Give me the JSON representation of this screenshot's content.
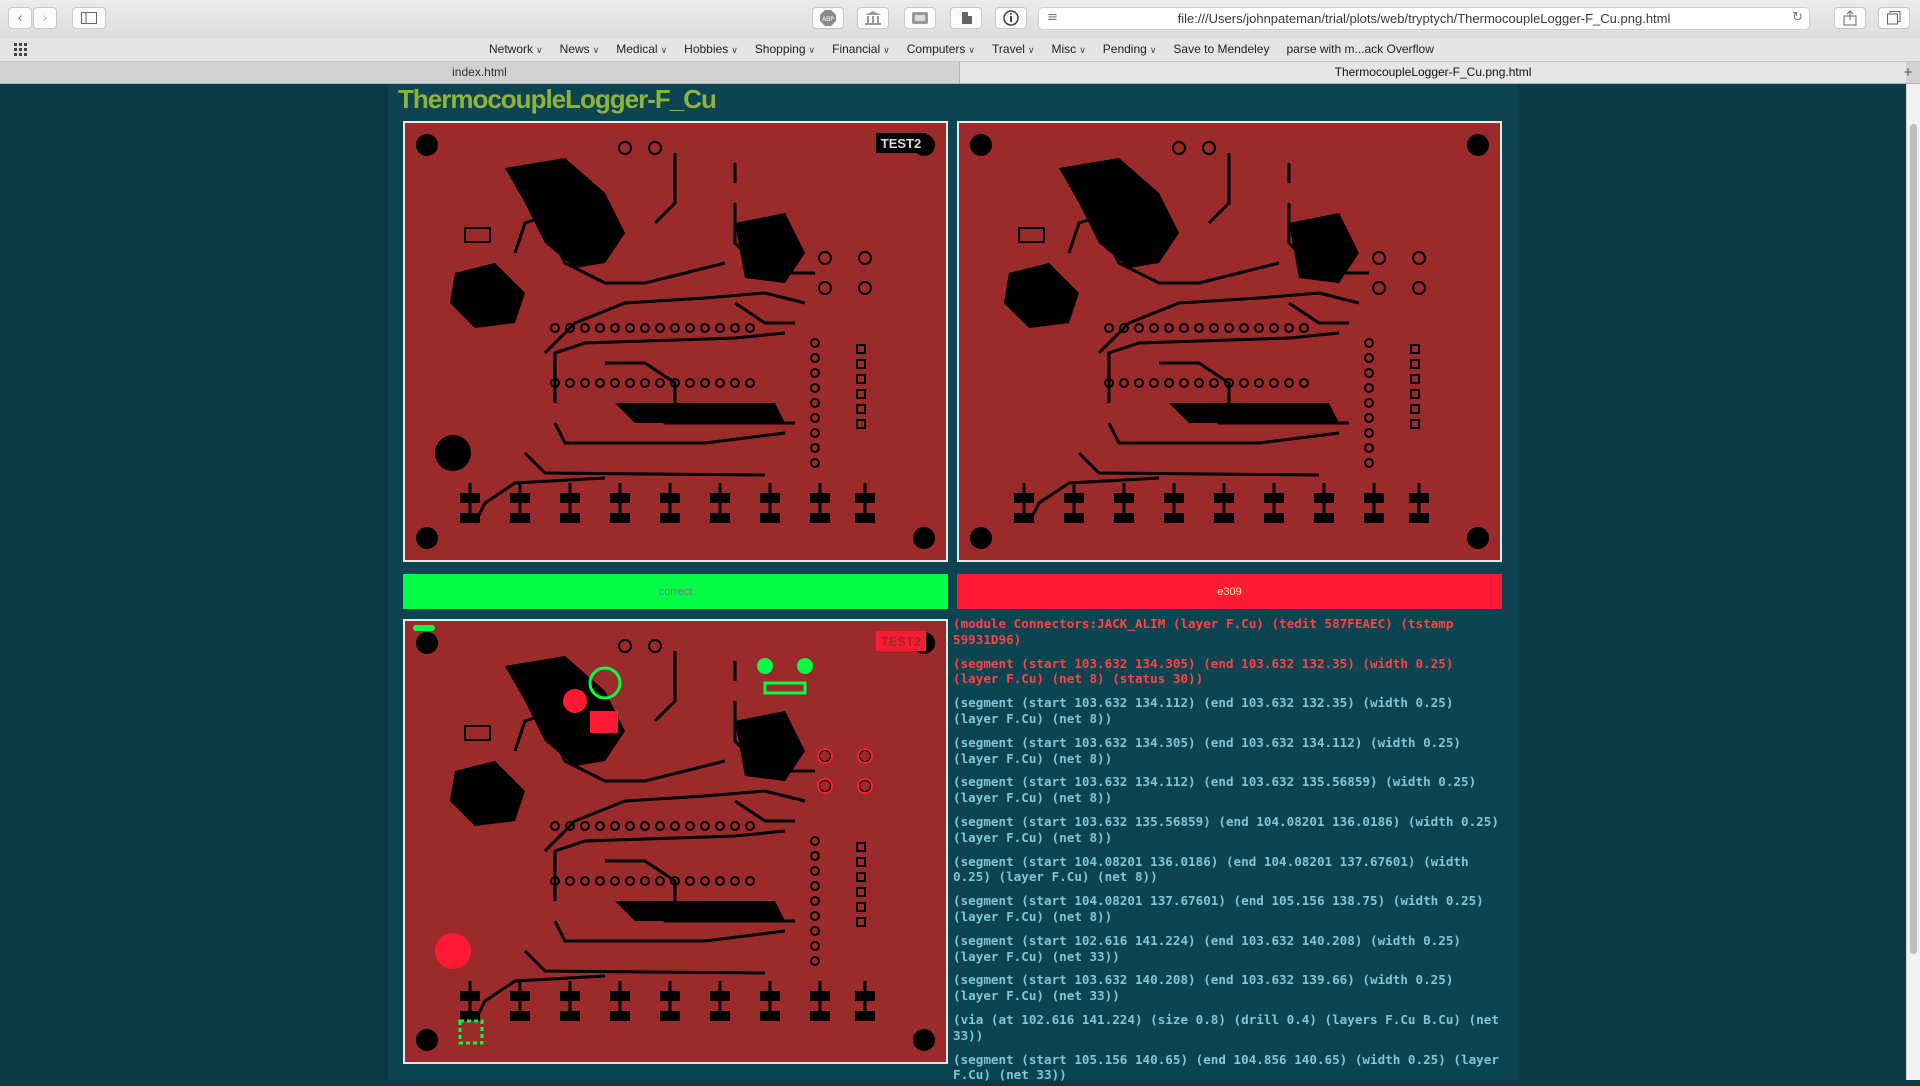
{
  "browser": {
    "url": "file:///Users/johnpateman/trial/plots/web/tryptych/ThermocoupleLogger-F_Cu.png.html",
    "toolbar_icons": [
      "back-icon",
      "forward-icon",
      "sidebar-icon",
      "adblock-icon",
      "library-icon",
      "bookmark-icon",
      "extension-icon",
      "info-icon",
      "reader-icon",
      "reload-icon",
      "share-icon",
      "tabs-icon"
    ],
    "bookmarks": [
      {
        "label": "Network",
        "menu": true
      },
      {
        "label": "News",
        "menu": true
      },
      {
        "label": "Medical",
        "menu": true
      },
      {
        "label": "Hobbies",
        "menu": true
      },
      {
        "label": "Shopping",
        "menu": true
      },
      {
        "label": "Financial",
        "menu": true
      },
      {
        "label": "Computers",
        "menu": true
      },
      {
        "label": "Travel",
        "menu": true
      },
      {
        "label": "Misc",
        "menu": true
      },
      {
        "label": "Pending",
        "menu": true
      },
      {
        "label": "Save to Mendeley",
        "menu": false
      },
      {
        "label": "parse with m...ack Overflow",
        "menu": false
      }
    ],
    "tabs": [
      {
        "label": "index.html",
        "active": false
      },
      {
        "label": "ThermocoupleLogger-F_Cu.png.html",
        "active": true
      }
    ]
  },
  "page": {
    "title": "ThermocoupleLogger-F_Cu",
    "panels": {
      "reference": {
        "label": "TEST2",
        "status": "correct",
        "status_color": "#00ff44",
        "status_text_color": "#7a7a7a"
      },
      "candidate": {
        "status": "e309",
        "status_color": "#ff1a33",
        "status_text_color": "#f3e9a0"
      },
      "diff": {
        "label": "TEST2"
      }
    },
    "colors": {
      "copper": "#9b2a2a",
      "trace": "#000000",
      "board_edge": "#e8e8e8",
      "diff_added": "#00ff44",
      "diff_removed": "#ff1a33",
      "background": "#0c4451"
    },
    "log": [
      {
        "text": "(module Connectors:JACK_ALIM (layer F.Cu) (tedit 587FEAEC) (tstamp 59931D96)",
        "error": true
      },
      {
        "text": "(segment (start 103.632 134.305) (end 103.632 132.35) (width 0.25) (layer F.Cu) (net 8) (status 30))",
        "error": true
      },
      {
        "text": "(segment (start 103.632 134.112) (end 103.632 132.35) (width 0.25) (layer F.Cu) (net 8))",
        "error": false
      },
      {
        "text": "(segment (start 103.632 134.305) (end 103.632 134.112) (width 0.25) (layer F.Cu) (net 8))",
        "error": false
      },
      {
        "text": "(segment (start 103.632 134.112) (end 103.632 135.56859) (width 0.25) (layer F.Cu) (net 8))",
        "error": false
      },
      {
        "text": "(segment (start 103.632 135.56859) (end 104.08201 136.0186) (width 0.25) (layer F.Cu) (net 8))",
        "error": false
      },
      {
        "text": "(segment (start 104.08201 136.0186) (end 104.08201 137.67601) (width 0.25) (layer F.Cu) (net 8))",
        "error": false
      },
      {
        "text": "(segment (start 104.08201 137.67601) (end 105.156 138.75) (width 0.25) (layer F.Cu) (net 8))",
        "error": false
      },
      {
        "text": "(segment (start 102.616 141.224) (end 103.632 140.208) (width 0.25) (layer F.Cu) (net 33))",
        "error": false
      },
      {
        "text": "(segment (start 103.632 140.208) (end 103.632 139.66) (width 0.25) (layer F.Cu) (net 33))",
        "error": false
      },
      {
        "text": "(via (at 102.616 141.224) (size 0.8) (drill 0.4) (layers F.Cu B.Cu) (net 33))",
        "error": false
      },
      {
        "text": "(segment (start 105.156 140.65) (end 104.856 140.65) (width 0.25) (layer F.Cu) (net 33))",
        "error": false
      }
    ]
  }
}
